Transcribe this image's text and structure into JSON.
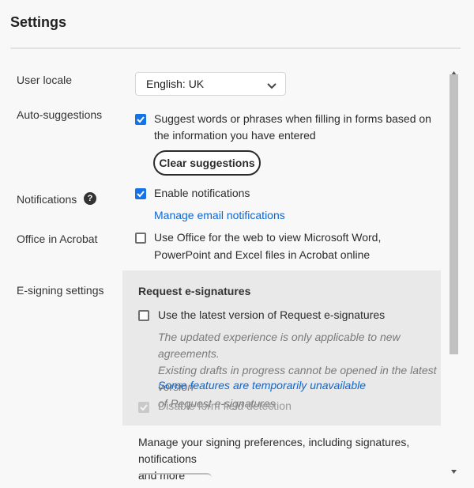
{
  "header": {
    "title": "Settings"
  },
  "user_locale": {
    "label": "User locale",
    "selected": "English: UK"
  },
  "auto_suggestions": {
    "label": "Auto-suggestions",
    "checkbox_line1": "Suggest words or phrases when filling in forms based on",
    "checkbox_line2": "the information you have entered",
    "checked": true,
    "clear_button": "Clear suggestions"
  },
  "notifications": {
    "label": "Notifications",
    "help_icon": "?",
    "checkbox_text": "Enable notifications",
    "checked": true,
    "manage_link": "Manage email notifications"
  },
  "office": {
    "label": "Office in Acrobat",
    "checkbox_line1": "Use Office for the web to view Microsoft Word,",
    "checkbox_line2": "PowerPoint and Excel files in Acrobat online",
    "checked": false
  },
  "esigning": {
    "label": "E-signing settings",
    "heading": "Request e-signatures",
    "latest_checkbox": "Use the latest version of Request e-signatures",
    "latest_checked": false,
    "note_line1": "The updated experience is only applicable to new agreements.",
    "note_line2": "Existing drafts in progress cannot be opened in the latest version",
    "note_line3": "of Request e-signatures",
    "unavailable_link": "Some features are temporarily unavailable",
    "disable_detection": "Disable form field detection",
    "disable_detection_checked": true,
    "manage_line1": "Manage your signing preferences, including signatures, notifications",
    "manage_line2": "and more"
  },
  "colors": {
    "accent": "#1473e6",
    "link": "#0d66d0",
    "panel_bg": "#e9e9e9"
  }
}
